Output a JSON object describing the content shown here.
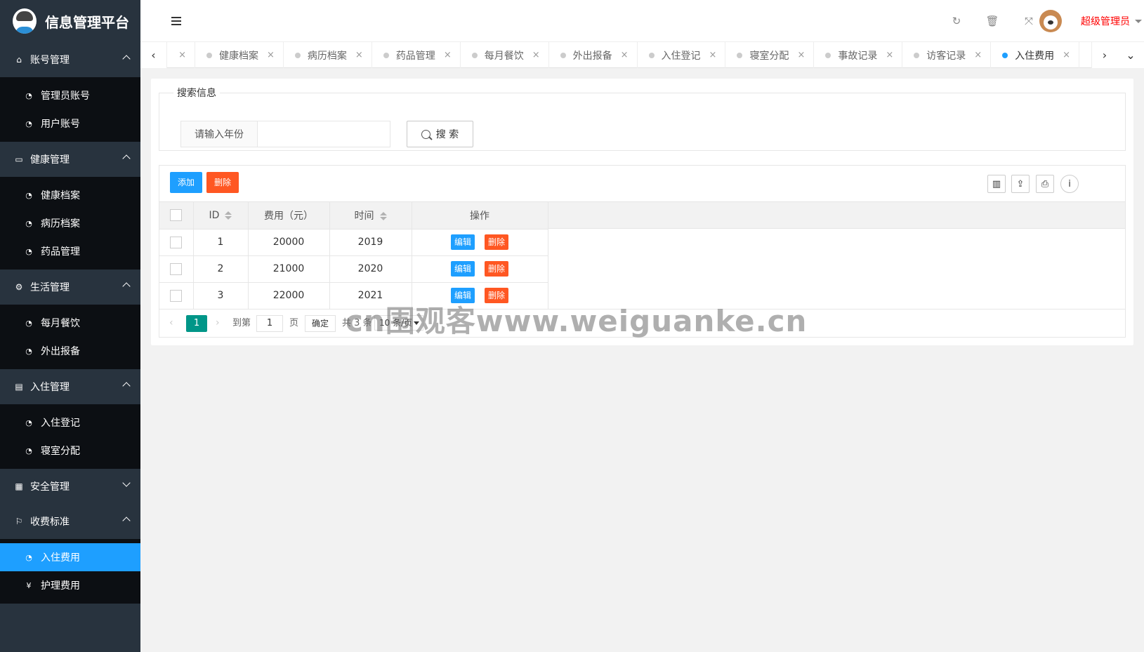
{
  "app": {
    "title": "信息管理平台"
  },
  "sidebar": {
    "groups": [
      {
        "label": "账号管理",
        "icon": "home-icon",
        "items": [
          {
            "label": "管理员账号"
          },
          {
            "label": "用户账号"
          }
        ]
      },
      {
        "label": "健康管理",
        "icon": "window-icon",
        "items": [
          {
            "label": "健康档案"
          },
          {
            "label": "病历档案"
          },
          {
            "label": "药品管理"
          }
        ]
      },
      {
        "label": "生活管理",
        "icon": "gears-icon",
        "items": [
          {
            "label": "每月餐饮"
          },
          {
            "label": "外出报备"
          }
        ]
      },
      {
        "label": "入住管理",
        "icon": "file-icon",
        "items": [
          {
            "label": "入住登记"
          },
          {
            "label": "寝室分配"
          }
        ]
      },
      {
        "label": "安全管理",
        "icon": "calendar-icon",
        "items": []
      },
      {
        "label": "收费标准",
        "icon": "flag-icon",
        "items": [
          {
            "label": "入住费用",
            "active": true
          },
          {
            "label": "护理费用"
          }
        ]
      }
    ]
  },
  "header": {
    "user_name": "超级管理员"
  },
  "tabs": {
    "items": [
      {
        "label": "健康档案"
      },
      {
        "label": "病历档案"
      },
      {
        "label": "药品管理"
      },
      {
        "label": "每月餐饮"
      },
      {
        "label": "外出报备"
      },
      {
        "label": "入住登记"
      },
      {
        "label": "寝室分配"
      },
      {
        "label": "事故记录"
      },
      {
        "label": "访客记录"
      },
      {
        "label": "入住费用",
        "active": true
      }
    ],
    "close_glyph": "×"
  },
  "search": {
    "legend": "搜索信息",
    "input_label": "请输入年份",
    "input_value": "",
    "button_label": "搜 索"
  },
  "toolbar": {
    "add_label": "添加",
    "delete_label": "删除"
  },
  "table": {
    "columns": [
      "ID",
      "费用（元）",
      "时间",
      "操作"
    ],
    "rows": [
      {
        "id": "1",
        "fee": "20000",
        "year": "2019"
      },
      {
        "id": "2",
        "fee": "21000",
        "year": "2020"
      },
      {
        "id": "3",
        "fee": "22000",
        "year": "2021"
      }
    ],
    "edit_label": "编辑",
    "delete_label": "删除"
  },
  "pager": {
    "current_page": "1",
    "goto_label": "到第",
    "goto_value": "1",
    "page_unit": "页",
    "confirm_label": "确定",
    "total_text": "共 3 条",
    "page_size": "10 条/页"
  },
  "watermark": "cn围观客www.weiguanke.cn",
  "colors": {
    "accent": "#1e9fff",
    "danger": "#ff5722",
    "sidebar": "#28333e",
    "user_name": "#ff0000",
    "pager_current": "#009688"
  }
}
